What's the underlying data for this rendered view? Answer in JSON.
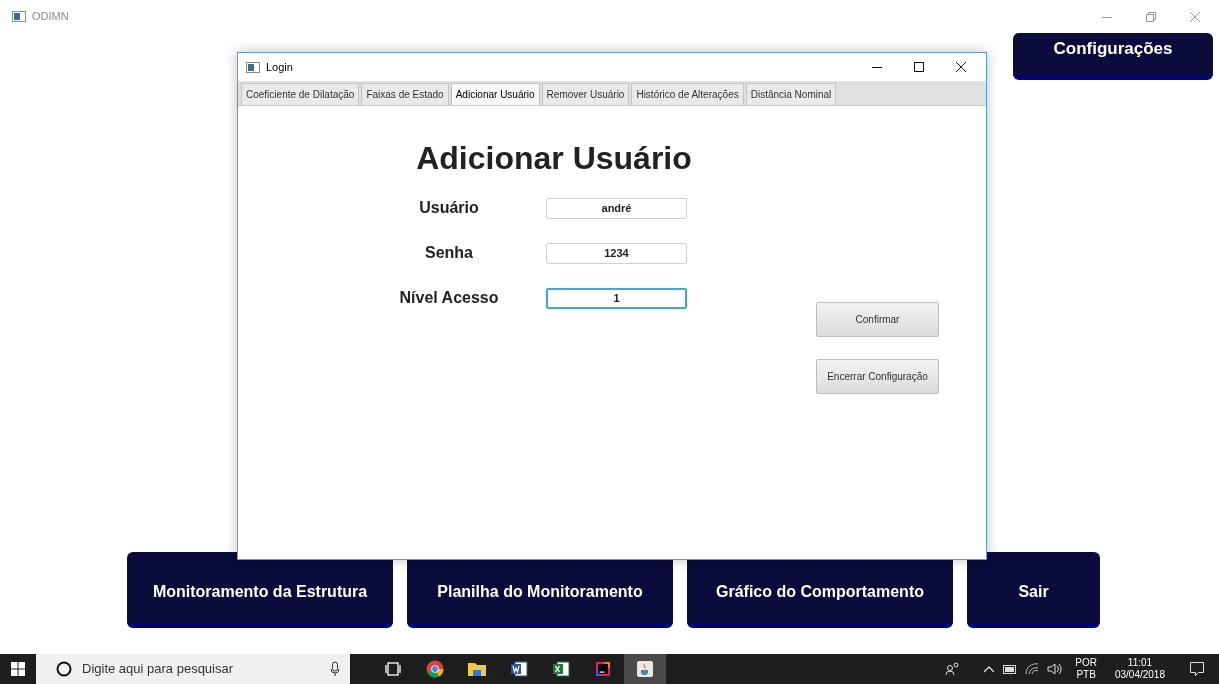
{
  "app": {
    "title": "ODIMN"
  },
  "config_button": "Configurações",
  "nav_buttons": [
    "Monitoramento da Estrutura",
    "Planilha do Monitoramento",
    "Gráfico do Comportamento",
    "Sair"
  ],
  "dialog": {
    "title": "Login",
    "tabs": [
      {
        "label": "Coeficiente de Dilatação",
        "selected": false
      },
      {
        "label": "Faixas de Estado",
        "selected": false
      },
      {
        "label": "Adicionar Usuário",
        "selected": true
      },
      {
        "label": "Remover Usuário",
        "selected": false
      },
      {
        "label": "Histórico de Alterações",
        "selected": false
      },
      {
        "label": "Distância Nominal",
        "selected": false
      }
    ],
    "heading": "Adicionar Usuário",
    "fields": [
      {
        "label": "Usuário",
        "value": "andré",
        "focused": false
      },
      {
        "label": "Senha",
        "value": "1234",
        "focused": false
      },
      {
        "label": "Nível Acesso",
        "value": "1",
        "focused": true
      }
    ],
    "buttons": [
      "Confirmar",
      "Encerrar Configuração"
    ]
  },
  "taskbar": {
    "search": {
      "placeholder": "Digite aqui para pesquisar"
    },
    "apps": [
      {
        "kind": "taskview",
        "active": false
      },
      {
        "kind": "browser",
        "active": false
      },
      {
        "kind": "folder",
        "active": false
      },
      {
        "kind": "word",
        "active": false
      },
      {
        "kind": "excel",
        "active": false
      },
      {
        "kind": "ide",
        "active": false
      },
      {
        "kind": "java",
        "active": true
      }
    ],
    "language": "POR",
    "layout": "PTB",
    "time": "11:01",
    "date": "03/04/2018"
  }
}
